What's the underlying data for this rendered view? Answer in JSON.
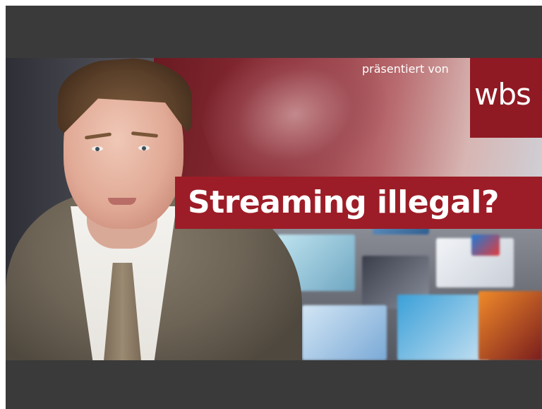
{
  "video": {
    "headline": "Streaming illegal?",
    "presented_by": "präsentiert von",
    "logo_text": "wbs"
  },
  "colors": {
    "banner_red": "#9c1d27",
    "logo_red": "#8f1a23",
    "letterbox": "#3a3a3a"
  }
}
